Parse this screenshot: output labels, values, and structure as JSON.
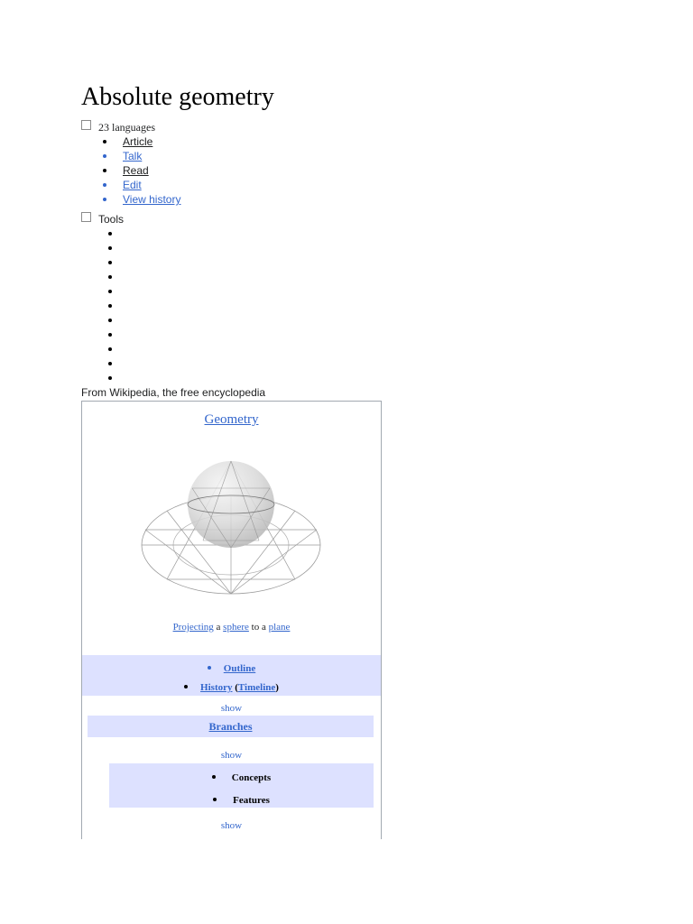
{
  "page": {
    "title": "Absolute geometry",
    "languages_label": "23 languages",
    "tools_label": "Tools",
    "tagline": "From Wikipedia, the free encyclopedia"
  },
  "nav": {
    "items": [
      {
        "label": "Article"
      },
      {
        "label": "Talk"
      },
      {
        "label": "Read"
      },
      {
        "label": "Edit"
      },
      {
        "label": "View history"
      }
    ]
  },
  "tools": {
    "empty_item_count": 11
  },
  "infobox": {
    "title": "Geometry",
    "image_icon": "projected-sphere-diagram",
    "caption": {
      "link1": "Projecting",
      "text1": " a ",
      "link2": "sphere",
      "text2": " to a ",
      "link3": "plane"
    },
    "outline": "Outline",
    "history": "History",
    "history_open": " (",
    "timeline": "Timeline",
    "history_close": ")",
    "show1": "show",
    "branches": "Branches",
    "show2": "show",
    "concepts": "Concepts",
    "features": "Features",
    "show3": "show"
  },
  "colors": {
    "link": "#3366cc",
    "band": "#dde1ff",
    "border": "#a2a9b1"
  }
}
